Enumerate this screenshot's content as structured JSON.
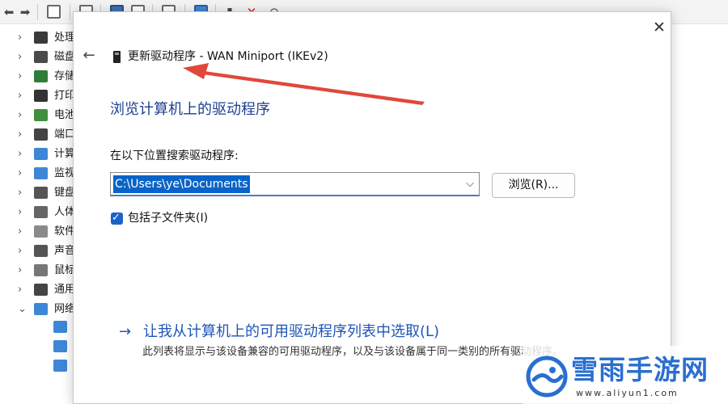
{
  "dialog": {
    "title": "更新驱动程序 - WAN Miniport (IKEv2)",
    "close_glyph": "✕",
    "back_glyph": "←",
    "section_heading": "浏览计算机上的驱动程序",
    "search_label": "在以下位置搜索驱动程序:",
    "path_value": "C:\\Users\\ye\\Documents",
    "combo_arrow_glyph": "⌵",
    "browse_label": "浏览(R)...",
    "include_subfolders_label": "包括子文件夹(I)",
    "include_subfolders_checked": true,
    "check_glyph": "✓",
    "pick_arrow_glyph": "→",
    "pick_from_list_label": "让我从计算机上的可用驱动程序列表中选取(L)",
    "pick_from_list_desc": "此列表将显示与该设备兼容的可用驱动程序，以及与该设备属于同一类别的所有驱动程序。"
  },
  "device_tree": {
    "items": [
      {
        "label": "处理器",
        "icon": "processor-icon",
        "color": "#3a3a3a"
      },
      {
        "label": "磁盘驱动器",
        "icon": "disk-drive-icon",
        "color": "#4a4a4a"
      },
      {
        "label": "存储控制器",
        "icon": "storage-controller-icon",
        "color": "#2f7d3a"
      },
      {
        "label": "打印队列",
        "icon": "printer-icon",
        "color": "#333333"
      },
      {
        "label": "电池",
        "icon": "battery-icon",
        "color": "#3f8f3f"
      },
      {
        "label": "端口 (COM 和 LPT)",
        "icon": "port-icon",
        "color": "#444444"
      },
      {
        "label": "计算机",
        "icon": "computer-icon",
        "color": "#3e87d6"
      },
      {
        "label": "监视器",
        "icon": "monitor-icon",
        "color": "#3e87d6"
      },
      {
        "label": "键盘",
        "icon": "keyboard-icon",
        "color": "#555555"
      },
      {
        "label": "人体学输入设备",
        "icon": "hid-icon",
        "color": "#666666"
      },
      {
        "label": "软件设备",
        "icon": "software-device-icon",
        "color": "#8a8a8a"
      },
      {
        "label": "声音、视频和游戏控制器",
        "icon": "speaker-icon",
        "color": "#555555"
      },
      {
        "label": "鼠标和其他指针设备",
        "icon": "mouse-icon",
        "color": "#777777"
      },
      {
        "label": "通用串行总线控制器",
        "icon": "usb-icon",
        "color": "#444444"
      },
      {
        "label": "网络适配器",
        "icon": "network-adapter-icon",
        "color": "#3e87d6"
      }
    ]
  },
  "watermark": {
    "brand": "雪雨手游网",
    "url": "www.aliyun1.com",
    "logo_color": "#2a6fd0"
  },
  "colors": {
    "accent": "#0a64c8",
    "heading": "#1e3f8f",
    "annotation_arrow": "#e0483a"
  }
}
